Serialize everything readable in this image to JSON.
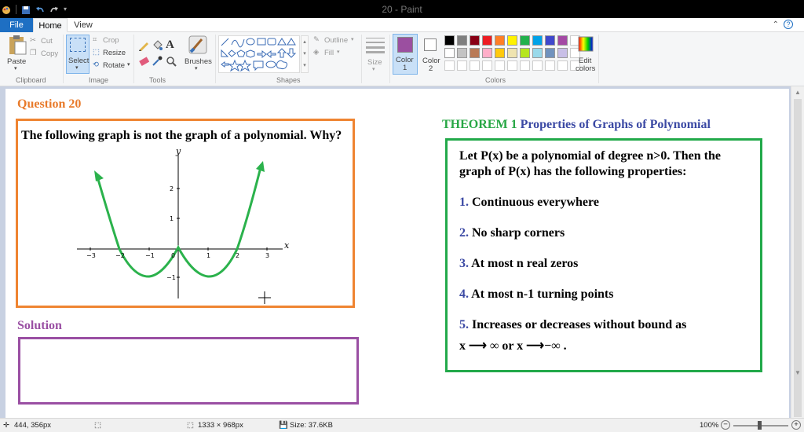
{
  "window": {
    "title": "20 - Paint"
  },
  "tabs": [
    {
      "label": "File"
    },
    {
      "label": "Home"
    },
    {
      "label": "View"
    }
  ],
  "ribbon": {
    "clipboard": {
      "paste": "Paste",
      "cut": "Cut",
      "copy": "Copy",
      "group": "Clipboard"
    },
    "image": {
      "select": "Select",
      "crop": "Crop",
      "resize": "Resize",
      "rotate": "Rotate",
      "group": "Image"
    },
    "tools": {
      "group": "Tools"
    },
    "brushes": {
      "label": "Brushes"
    },
    "shapes": {
      "outline": "Outline",
      "fill": "Fill",
      "group": "Shapes"
    },
    "size": {
      "label": "Size"
    },
    "color1": {
      "label": "Color",
      "num": "1",
      "value": "#9b4fa0"
    },
    "color2": {
      "label": "Color",
      "num": "2",
      "value": "#ffffff"
    },
    "colors": {
      "group": "Colors",
      "edit_label": "Edit",
      "edit_label2": "colors"
    },
    "palette_row1": [
      "#000000",
      "#7f7f7f",
      "#880015",
      "#ed1c24",
      "#ff7f27",
      "#fff200",
      "#22b14c",
      "#00a2e8",
      "#3f48cc",
      "#a349a4"
    ],
    "palette_row2": [
      "#ffffff",
      "#c3c3c3",
      "#b97a57",
      "#ffaec9",
      "#ffc90e",
      "#efe4b0",
      "#b5e61d",
      "#99d9ea",
      "#7092be",
      "#c8bfe7"
    ]
  },
  "canvas": {
    "question_title": "Question  20",
    "question_text": "The following graph is not the graph of a polynomial. Why?",
    "graph": {
      "x_axis_label": "x",
      "y_axis_label": "y",
      "x_ticks": [
        "−3",
        "−2",
        "−1",
        "0",
        "1",
        "2",
        "3"
      ],
      "y_ticks": [
        "2",
        "1",
        "−1"
      ]
    },
    "solution_title": "Solution",
    "theorem_label": "THEOREM 1",
    "theorem_title": " Properties of Graphs of Polynomial",
    "theorem_intro_1": "Let P(x) be a polynomial of degree n>0. Then the",
    "theorem_intro_2": "graph of P(x) has the following properties:",
    "properties": [
      {
        "num": "1.",
        "text": " Continuous everywhere"
      },
      {
        "num": "2.",
        "text": " No sharp corners"
      },
      {
        "num": "3.",
        "text": " At most n real zeros"
      },
      {
        "num": "4.",
        "text": " At most n-1 turning points"
      },
      {
        "num": "5.",
        "text": " Increases or decreases without bound as"
      }
    ],
    "limit_line": "x ⟶  ∞  or  x ⟶−∞ ."
  },
  "statusbar": {
    "cursor_pos": "444, 356px",
    "image_size": "1333 × 968px",
    "file_size": "Size: 37.6KB",
    "zoom": "100%"
  }
}
